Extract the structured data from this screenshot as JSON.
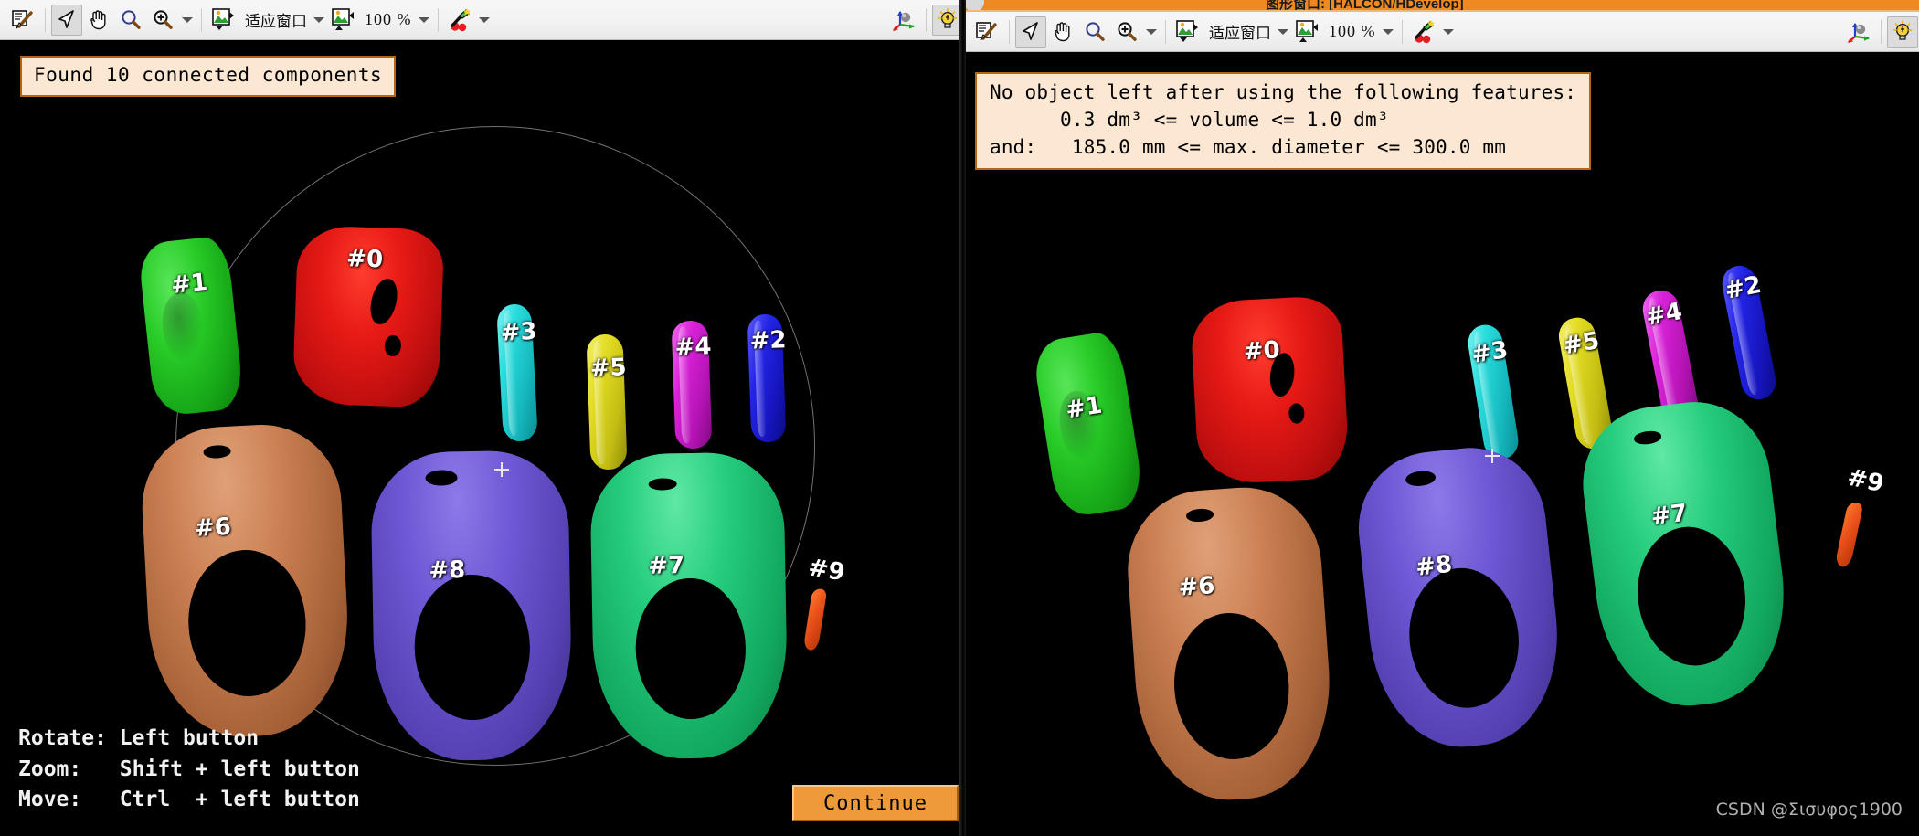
{
  "window": {
    "right_title": "图形窗口: [HALCON/HDevelop]"
  },
  "toolbar": {
    "icons": [
      {
        "name": "edit-pen-icon",
        "label": "编辑"
      },
      {
        "name": "arrow-select-icon",
        "label": "选择"
      },
      {
        "name": "pan-hand-icon",
        "label": "移动"
      },
      {
        "name": "magnifier-icon",
        "label": "缩放"
      },
      {
        "name": "zoom-in-icon",
        "label": "放大"
      },
      {
        "name": "fit-window-icon",
        "label": "适应窗口"
      },
      {
        "name": "zoom-level-icon",
        "label": "缩放比例"
      },
      {
        "name": "color-picker-icon",
        "label": "取色"
      },
      {
        "name": "axes-3d-icon",
        "label": "3D坐标轴"
      },
      {
        "name": "light-bulb-icon",
        "label": "光照"
      }
    ],
    "fit_mode_label": "适应窗口",
    "zoom_label": "100 %"
  },
  "left_panel": {
    "message": "Found 10 connected components",
    "hints": "Rotate: Left button\nZoom:   Shift + left button\nMove:   Ctrl  + left button",
    "continue_label": "Continue",
    "objects": [
      {
        "id": "#1",
        "color": "#1db81d",
        "shape": "slab"
      },
      {
        "id": "#0",
        "color": "#d41414",
        "shape": "sacrum"
      },
      {
        "id": "#3",
        "color": "#1fd3d3",
        "shape": "rod"
      },
      {
        "id": "#5",
        "color": "#d8d020",
        "shape": "rod"
      },
      {
        "id": "#4",
        "color": "#cc22cc",
        "shape": "rod"
      },
      {
        "id": "#2",
        "color": "#1a1ad6",
        "shape": "rod"
      },
      {
        "id": "#6",
        "color": "#c77c52",
        "shape": "ring"
      },
      {
        "id": "#8",
        "color": "#6a52cc",
        "shape": "ring"
      },
      {
        "id": "#7",
        "color": "#19b96a",
        "shape": "ring"
      },
      {
        "id": "#9",
        "color": "#e04f16",
        "shape": "sliver"
      }
    ]
  },
  "right_panel": {
    "message": "No object left after using the following features:\n      0.3 dm³ <= volume <= 1.0 dm³\nand:   185.0 mm <= max. diameter <= 300.0 mm",
    "watermark": "CSDN @Σισυφος1900",
    "objects": [
      {
        "id": "#1",
        "color": "#1db81d",
        "shape": "slab"
      },
      {
        "id": "#0",
        "color": "#d41414",
        "shape": "sacrum"
      },
      {
        "id": "#3",
        "color": "#1fd3d3",
        "shape": "rod"
      },
      {
        "id": "#5",
        "color": "#d8d020",
        "shape": "rod"
      },
      {
        "id": "#4",
        "color": "#cc22cc",
        "shape": "rod"
      },
      {
        "id": "#2",
        "color": "#1a1ad6",
        "shape": "rod"
      },
      {
        "id": "#6",
        "color": "#c77c52",
        "shape": "ring"
      },
      {
        "id": "#8",
        "color": "#6a52cc",
        "shape": "ring"
      },
      {
        "id": "#7",
        "color": "#19b96a",
        "shape": "ring"
      },
      {
        "id": "#9",
        "color": "#e04f16",
        "shape": "sliver"
      }
    ]
  },
  "colors": {
    "banner_bg": "#fbe7d2",
    "banner_border": "#b4651a",
    "button_orange": "#ef9a3a",
    "titlebar_orange": "#ef8a22",
    "canvas_bg": "#000000"
  }
}
